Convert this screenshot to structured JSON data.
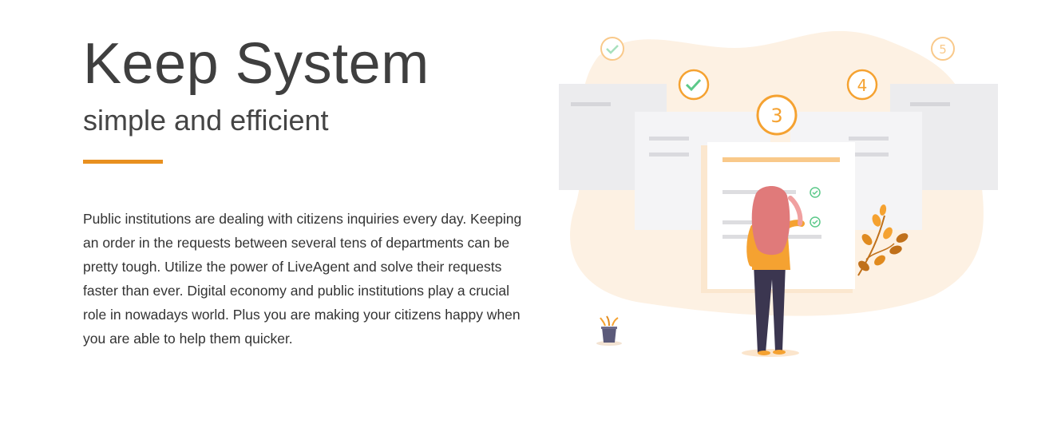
{
  "hero": {
    "title": "Keep System",
    "subtitle": "simple and efficient",
    "body": "Public institutions are dealing with citizens inquiries every day. Keeping an order in the requests between several tens of departments can be pretty tough. Utilize the power of LiveAgent and solve their requests faster than ever. Digital economy and public institutions play a crucial role in nowadays world. Plus you are making your citizens happy when you are able to help them quicker."
  },
  "illustration": {
    "steps": [
      "3",
      "4",
      "5"
    ],
    "colors": {
      "accent": "#e8901f",
      "check": "#5cc98a",
      "blob": "#fdf1e3",
      "card": "#ececee",
      "hair": "#e07a7a",
      "shirt": "#f5a231",
      "pants": "#3b3650",
      "leaf": "#e08a1e",
      "pot": "#5b5a7a"
    }
  }
}
